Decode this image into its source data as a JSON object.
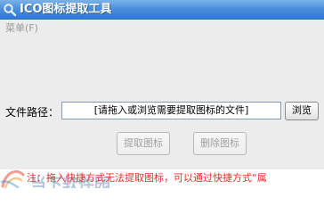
{
  "window": {
    "title": "ICO图标提取工具",
    "title_icon": "search-icon"
  },
  "menubar": {
    "items": [
      {
        "label": "菜单(F)"
      }
    ]
  },
  "form": {
    "path_label": "文件路径：",
    "path_value": "[请拖入或浏览需要提取图标的文件]",
    "browse_label": "浏览"
  },
  "actions": {
    "extract_label": "提取图标",
    "delete_label": "删除图标"
  },
  "footer": {
    "note": "注：拖入快捷方式无法提取图标，可以通过快捷方式“属",
    "note_color": "#e0302a",
    "logo_icon": "swirl-logo-icon",
    "logo_text": "当下软件园"
  },
  "colors": {
    "titlebar": "#4a8fdb",
    "window_bg": "#ececec"
  }
}
